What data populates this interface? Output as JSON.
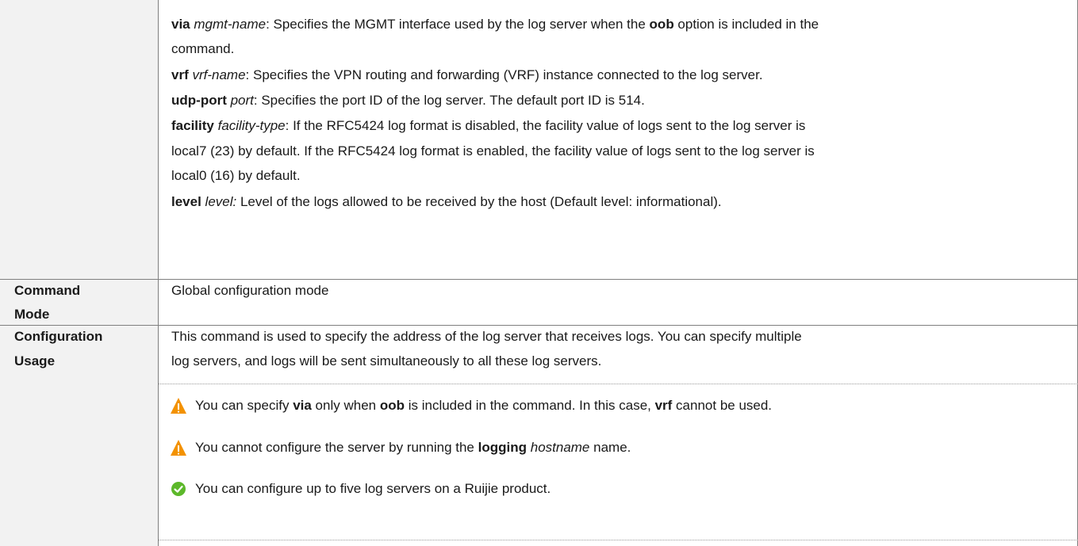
{
  "parameters": {
    "via_line1_parts": [
      {
        "t": "via",
        "s": "b"
      },
      {
        "t": " ",
        "s": ""
      },
      {
        "t": "mgmt-name",
        "s": "i"
      },
      {
        "t": ": Specifies the MGMT interface used by the log server when the ",
        "s": ""
      },
      {
        "t": "oob",
        "s": "b"
      },
      {
        "t": " option is included in the",
        "s": ""
      }
    ],
    "via_line2": "command.",
    "vrf_parts": [
      {
        "t": "vrf",
        "s": "b"
      },
      {
        "t": " ",
        "s": ""
      },
      {
        "t": "vrf-name",
        "s": "i"
      },
      {
        "t": ": Specifies the VPN routing and forwarding (VRF) instance connected to the log server.",
        "s": ""
      }
    ],
    "udp_parts": [
      {
        "t": "udp-port",
        "s": "b"
      },
      {
        "t": " ",
        "s": ""
      },
      {
        "t": "port",
        "s": "i"
      },
      {
        "t": ": Specifies the port ID of the log server. The default port ID is 514.",
        "s": ""
      }
    ],
    "facility_line1_parts": [
      {
        "t": "facility",
        "s": "b"
      },
      {
        "t": " ",
        "s": ""
      },
      {
        "t": "facility-type",
        "s": "i"
      },
      {
        "t": ": If the RFC5424 log format is disabled, the facility value of logs sent to the log server is",
        "s": ""
      }
    ],
    "facility_line2": "local7 (23) by default. If the RFC5424 log format is enabled, the facility value of logs sent to the log server is",
    "facility_line3": "local0 (16) by default.",
    "level_parts": [
      {
        "t": "level",
        "s": "b"
      },
      {
        "t": " ",
        "s": ""
      },
      {
        "t": "level:",
        "s": "i"
      },
      {
        "t": " Level of the logs allowed to be received by the host (Default level: informational).",
        "s": ""
      }
    ]
  },
  "command_mode": {
    "label_line1": "Command",
    "label_line2": "Mode",
    "value": "Global configuration mode"
  },
  "configuration_usage": {
    "label_line1": "Configuration",
    "label_line2": "Usage",
    "line1": "This command is used to specify the address of the log server that receives logs. You can specify multiple",
    "line2": "log servers, and logs will be sent simultaneously to all these log servers.",
    "notes": [
      {
        "icon": "warning-icon",
        "parts": [
          {
            "t": "You can specify ",
            "s": ""
          },
          {
            "t": "via",
            "s": "b"
          },
          {
            "t": " only when ",
            "s": ""
          },
          {
            "t": "oob",
            "s": "b"
          },
          {
            "t": " is included in the command. In this case, ",
            "s": ""
          },
          {
            "t": "vrf",
            "s": "b"
          },
          {
            "t": " cannot be used.",
            "s": ""
          }
        ]
      },
      {
        "icon": "warning-icon",
        "parts": [
          {
            "t": "You cannot configure the server by running the ",
            "s": ""
          },
          {
            "t": "logging",
            "s": "b"
          },
          {
            "t": " ",
            "s": ""
          },
          {
            "t": "hostname",
            "s": "i"
          },
          {
            "t": " name.",
            "s": ""
          }
        ]
      },
      {
        "icon": "check-icon",
        "parts": [
          {
            "t": "You can configure up to five log servers on a Ruijie product.",
            "s": ""
          }
        ]
      }
    ]
  },
  "colors": {
    "warning": "#f39200",
    "check": "#5cb82a",
    "label_bg": "#f2f2f2",
    "border": "#7f7f7f"
  }
}
